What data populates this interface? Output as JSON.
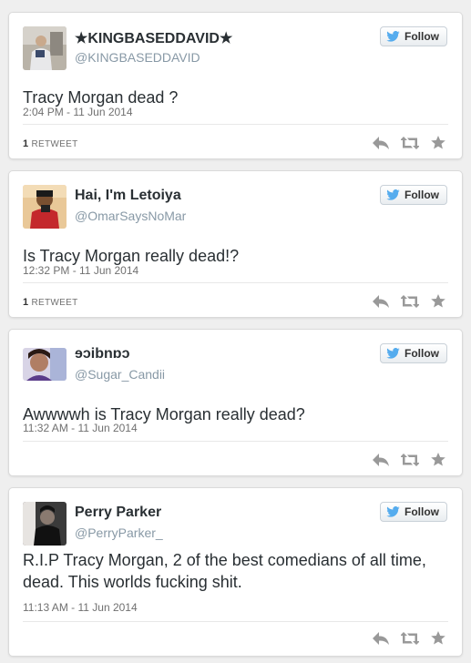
{
  "follow_label": "Follow",
  "retweet_word": "RETWEET",
  "colors": {
    "follow_bird": "#55acee",
    "icon": "#999999",
    "background": "#efefef"
  },
  "icons": {
    "reply": "reply-icon",
    "retweet": "retweet-icon",
    "favorite": "star-icon",
    "follow": "twitter-bird-icon"
  },
  "tweets": [
    {
      "name": "★KINGBASEDDAVID★",
      "handle": "@KINGBASEDDAVID",
      "text": "Tracy Morgan dead ?",
      "time": "2:04 PM - 11 Jun 2014",
      "retweet_count": "1"
    },
    {
      "name": "Hai, I'm Letoiya",
      "handle": "@OmarSaysNoMar",
      "text": "Is Tracy Morgan really dead!?",
      "time": "12:32 PM - 11 Jun 2014",
      "retweet_count": "1"
    },
    {
      "name": "ɘɔibnɒɔ",
      "handle": "@Sugar_Candii",
      "text": "Awwwwh is Tracy Morgan really dead?",
      "time": "11:32 AM - 11 Jun 2014",
      "retweet_count": ""
    },
    {
      "name": "Perry Parker",
      "handle": "@PerryParker_",
      "text": "R.I.P Tracy Morgan, 2 of the best comedians of all time, dead. This worlds fucking shit.",
      "time": "11:13 AM - 11 Jun 2014",
      "retweet_count": ""
    }
  ]
}
